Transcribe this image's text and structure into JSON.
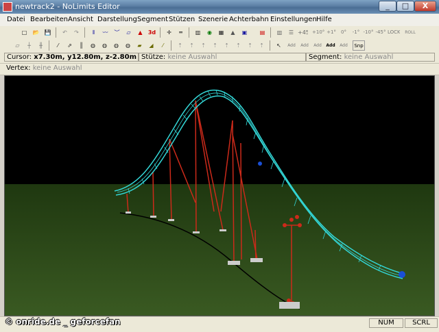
{
  "window": {
    "title": "newtrack2 - NoLimits Editor",
    "minimize": "_",
    "maximize": "□",
    "close": "X"
  },
  "menu": [
    "Datei",
    "Bearbeiten",
    "Ansicht",
    "Darstellung",
    "Segment",
    "Stützen",
    "Szenerie",
    "Achterbahn",
    "Einstellungen",
    "Hilfe"
  ],
  "toolbar1": [
    "□",
    "📂",
    "💾",
    "↶",
    "↷",
    "⦀",
    "〰",
    "︶",
    "▱",
    "▲",
    "3d",
    "✛",
    "═",
    "▥",
    "◉",
    "▦",
    "▲",
    "▣",
    "▤",
    "▥",
    "☰",
    "+45°",
    "+10°",
    "+1°",
    "0°",
    "-1°",
    "-10°",
    "-45°",
    "LOCK",
    "ROLL"
  ],
  "toolbar2": [
    "▱",
    "┼",
    "╫",
    "⁄",
    "⇗",
    "║",
    "◍",
    "◍",
    "◍",
    "◍",
    "▰",
    "◢",
    "⁄",
    "⇡",
    "⇡",
    "⇡",
    "⇡",
    "⇡",
    "⇡",
    "⇡",
    "⇡",
    "↖",
    "Add",
    "Add",
    "Add",
    "Add",
    "Add",
    "Snp"
  ],
  "info": {
    "cursor_label": "Cursor:",
    "cursor_value": "x7.30m, y12.80m, z-2.80m",
    "stuetze_label": "Stütze:",
    "stuetze_value": "keine Auswahl",
    "segment_label": "Segment:",
    "segment_value": "keine Auswahl",
    "vertex_label": "Vertex:",
    "vertex_value": "keine Auswahl"
  },
  "status": {
    "num": "NUM",
    "scrl": "SCRL"
  },
  "watermark": "© onride.de _ geforcefan",
  "colors": {
    "sky": "#000000",
    "ground": "#2c4a16",
    "track": "#33d6d6",
    "support": "#cc2a1a",
    "footer": "#cccccc"
  }
}
